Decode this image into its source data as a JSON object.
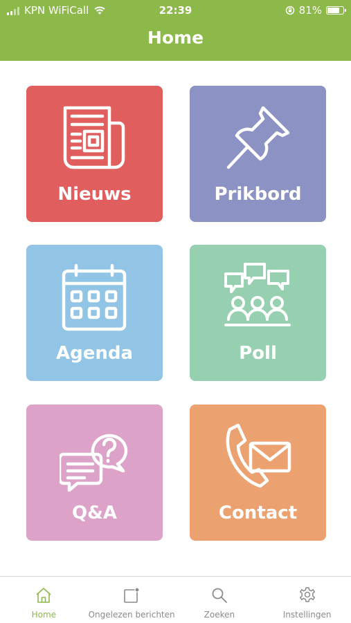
{
  "status_bar": {
    "carrier": "KPN WiFiCall",
    "time": "22:39",
    "battery": "81%",
    "battery_level": 0.81
  },
  "header": {
    "title": "Home"
  },
  "tiles": [
    {
      "label": "Nieuws",
      "icon": "newspaper-icon",
      "color": "#e05f5e"
    },
    {
      "label": "Prikbord",
      "icon": "pushpin-icon",
      "color": "#8d92c4"
    },
    {
      "label": "Agenda",
      "icon": "calendar-icon",
      "color": "#92c5e5"
    },
    {
      "label": "Poll",
      "icon": "group-chat-icon",
      "color": "#96d0b0"
    },
    {
      "label": "Q&A",
      "icon": "question-chat-icon",
      "color": "#dca2c8"
    },
    {
      "label": "Contact",
      "icon": "phone-mail-icon",
      "color": "#eba270"
    }
  ],
  "nav": [
    {
      "label": "Home",
      "icon": "home-icon",
      "active": true
    },
    {
      "label": "Ongelezen berichten",
      "icon": "unread-messages-icon",
      "active": false
    },
    {
      "label": "Zoeken",
      "icon": "search-icon",
      "active": false
    },
    {
      "label": "Instellingen",
      "icon": "gear-icon",
      "active": false
    }
  ],
  "colors": {
    "accent": "#8db84a",
    "nav_inactive": "#8a8a8a"
  }
}
